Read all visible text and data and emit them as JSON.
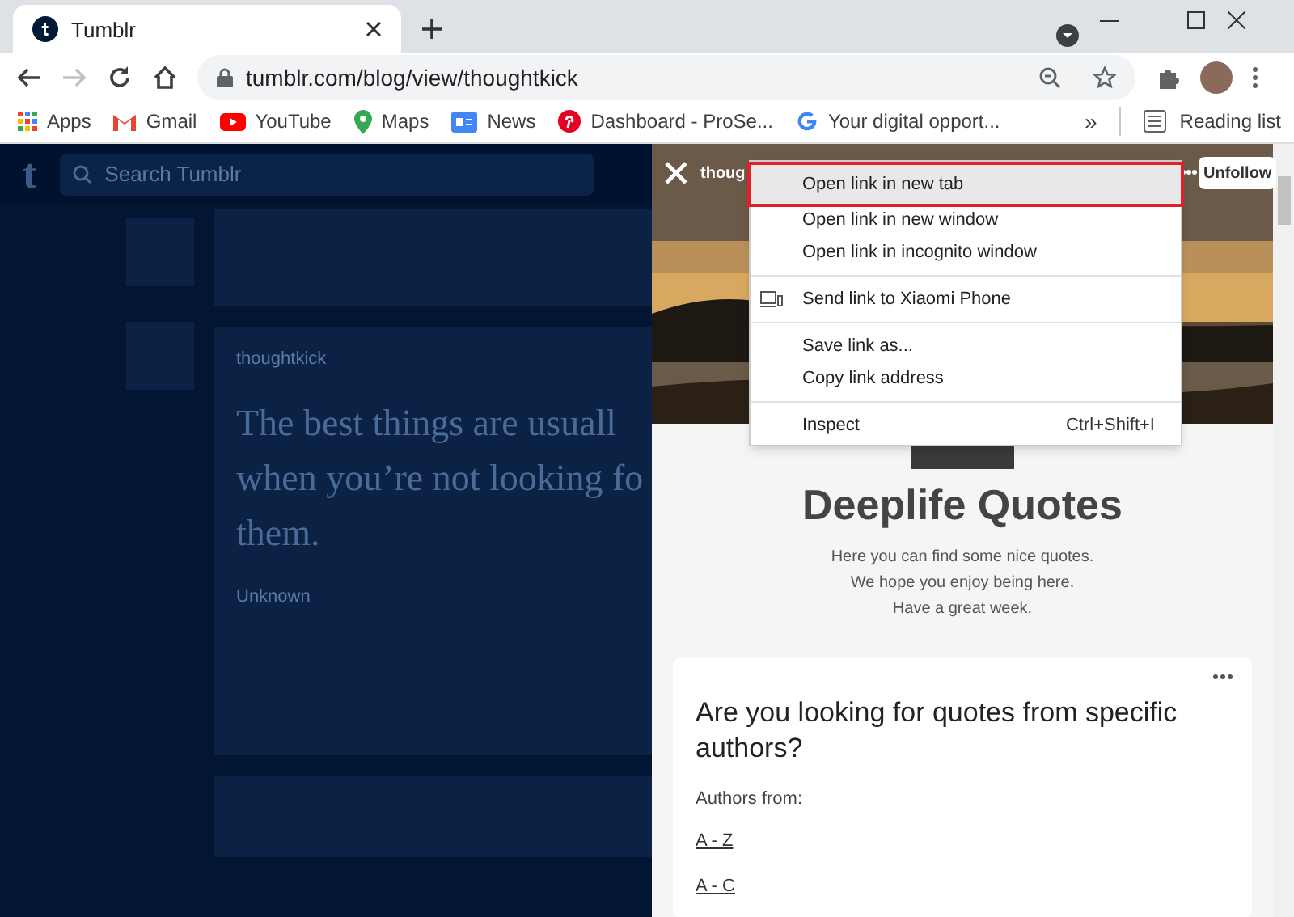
{
  "browser": {
    "tab": {
      "title": "Tumblr"
    },
    "address": "tumblr.com/blog/view/thoughtkick",
    "bookmarks": [
      {
        "label": "Apps",
        "kind": "apps"
      },
      {
        "label": "Gmail",
        "kind": "gmail"
      },
      {
        "label": "YouTube",
        "kind": "youtube"
      },
      {
        "label": "Maps",
        "kind": "maps"
      },
      {
        "label": "News",
        "kind": "news"
      },
      {
        "label": "Dashboard - ProSe...",
        "kind": "pinterest"
      },
      {
        "label": "Your digital opport...",
        "kind": "google"
      }
    ],
    "more": "»",
    "reading_list": "Reading list"
  },
  "dashboard": {
    "logo": "t",
    "search_placeholder": "Search Tumblr",
    "post": {
      "author": "thoughtkick",
      "quote_lines": [
        "The best things are usuall",
        "when you’re not looking fo",
        "them."
      ],
      "source": "Unknown"
    }
  },
  "blog_panel": {
    "blog_name": "thoug",
    "follow_button": "Unfollow",
    "title": "Deeplife Quotes",
    "description": [
      "Here you can find some nice quotes.",
      "We hope you enjoy being here.",
      "Have a great week."
    ],
    "post": {
      "heading": "Are you looking for quotes from specific authors?",
      "intro": "Authors from:",
      "links": [
        "A - Z",
        "A - C"
      ]
    }
  },
  "context_menu": {
    "groups": [
      [
        {
          "label": "Open link in new tab",
          "kind": "plain",
          "selected": true
        },
        {
          "label": "Open link in new window",
          "kind": "plain",
          "selected": false
        },
        {
          "label": "Open link in incognito window",
          "kind": "plain",
          "selected": false
        }
      ],
      [
        {
          "label": "Send link to Xiaomi Phone",
          "kind": "device",
          "selected": false
        }
      ],
      [
        {
          "label": "Save link as...",
          "kind": "plain",
          "selected": false
        },
        {
          "label": "Copy link address",
          "kind": "plain",
          "selected": false
        }
      ],
      [
        {
          "label": "Inspect",
          "kind": "plain",
          "selected": false,
          "shortcut": "Ctrl+Shift+I"
        }
      ]
    ]
  }
}
